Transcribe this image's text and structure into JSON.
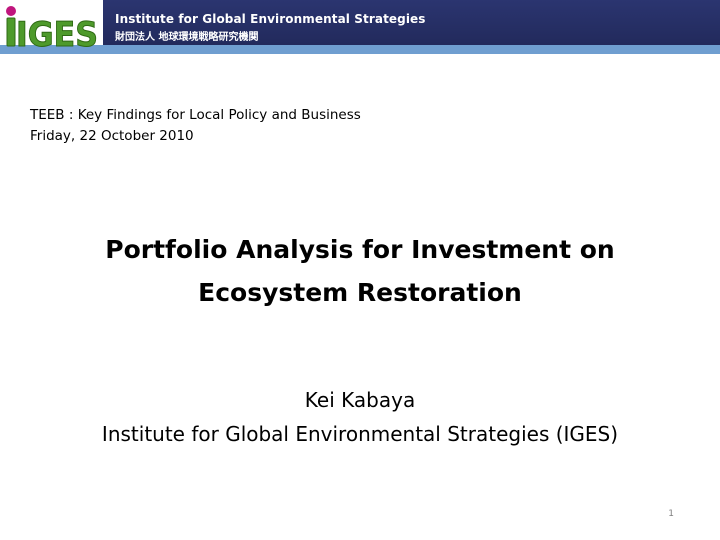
{
  "header": {
    "logo_text": "IGES",
    "org_name_en": "Institute for Global Environmental Strategies",
    "org_name_jp": "財団法人 地球環境戦略研究機関",
    "colors": {
      "navy": "#252d62",
      "blue_band": "#6f9ed0",
      "logo_green": "#4e9a2b",
      "logo_magenta": "#c0157d"
    }
  },
  "event": {
    "line1": "TEEB : Key Findings for Local Policy and Business",
    "line2": "Friday, 22 October 2010"
  },
  "title": {
    "line1": "Portfolio Analysis for Investment on",
    "line2": "Ecosystem Restoration"
  },
  "author": {
    "name": "Kei Kabaya",
    "affiliation": "Institute for Global Environmental Strategies (IGES)"
  },
  "slide_number": "1"
}
